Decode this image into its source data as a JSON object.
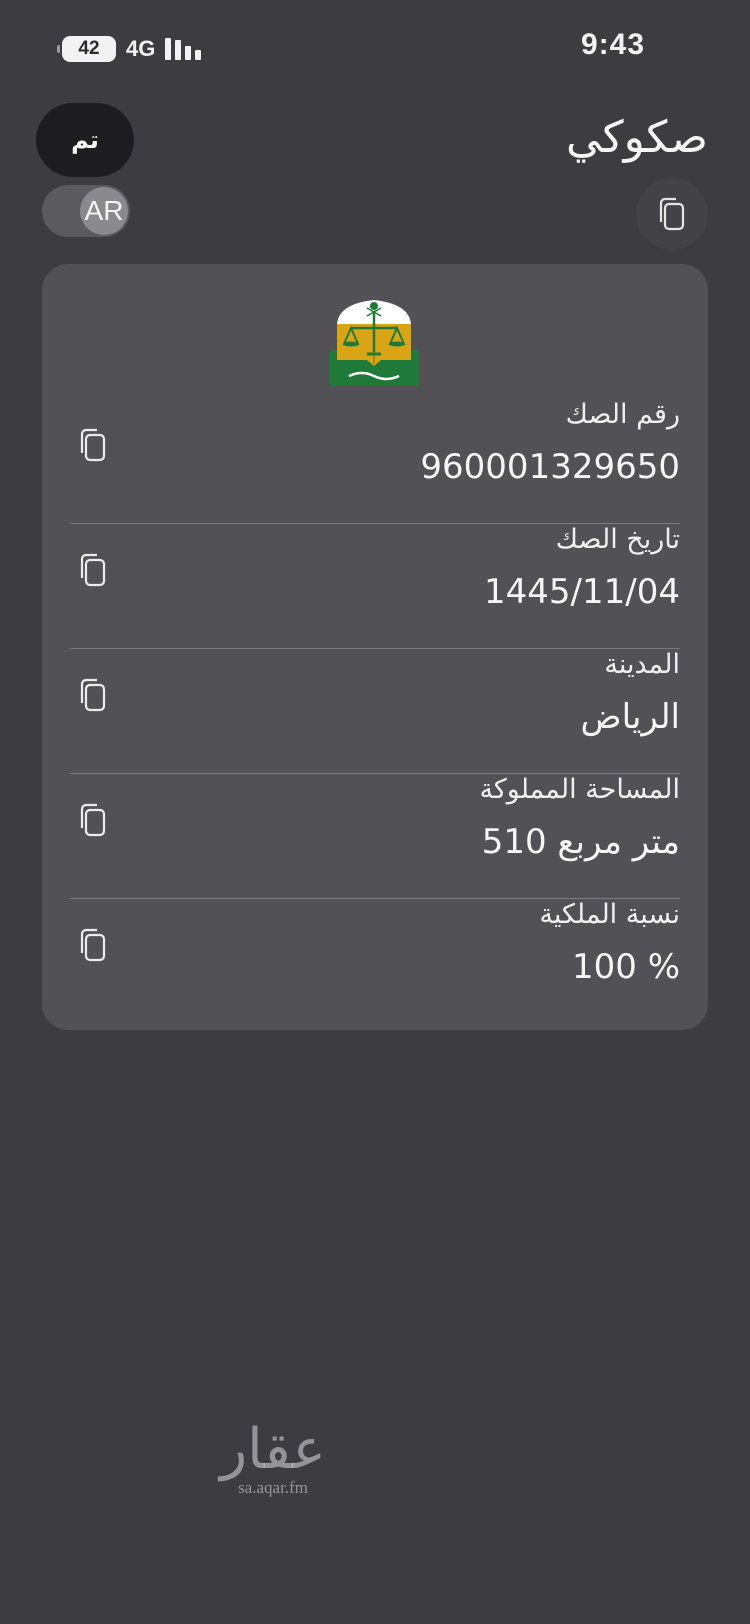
{
  "status_bar": {
    "time": "9:43",
    "battery": "42",
    "network": "4G",
    "signal_icon": "signal-bars-icon"
  },
  "header": {
    "done_label": "تم",
    "language_label": "AR",
    "title": "صكوكي",
    "copy_icon": "copy-icon"
  },
  "card": {
    "emblem": "ministry-of-justice-emblem",
    "fields": [
      {
        "label": "رقم الصك",
        "value": "960001329650"
      },
      {
        "label": "تاريخ الصك",
        "value": "1445/11/04"
      },
      {
        "label": "المدينة",
        "value": "الرياض"
      },
      {
        "label": "المساحة المملوكة",
        "value": "510 متر مربع"
      },
      {
        "label": "نسبة الملكية",
        "value": "100 %"
      }
    ]
  },
  "watermark": {
    "logo_text": "عقار",
    "url": "sa.aqar.fm"
  },
  "colors": {
    "background": "#3d3c40",
    "card": "#525155",
    "button_dark": "#1d1d1f",
    "emblem_green": "#1f7a3a",
    "emblem_gold": "#d9a514"
  }
}
